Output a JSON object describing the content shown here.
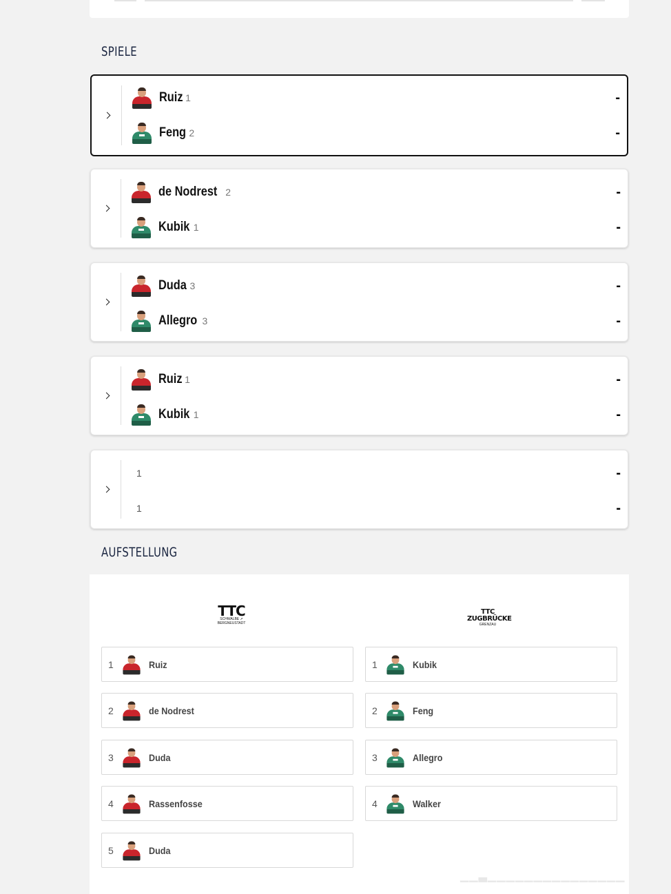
{
  "sections": {
    "games_title": "SPIELE",
    "lineup_title": "AUFSTELLUNG"
  },
  "colors": {
    "home_jersey": "#c9252c",
    "away_jersey": "#2f8a69",
    "title": "#1a2540"
  },
  "games": [
    {
      "home": {
        "name": "Ruiz",
        "seed": "1",
        "score": "-"
      },
      "away": {
        "name": "Feng",
        "seed": "2",
        "score": "-"
      }
    },
    {
      "home": {
        "name": "de Nodrest",
        "seed": "2",
        "score": "-"
      },
      "away": {
        "name": "Kubik",
        "seed": "1",
        "score": "-"
      }
    },
    {
      "home": {
        "name": "Duda",
        "seed": "3",
        "score": "-"
      },
      "away": {
        "name": "Allegro",
        "seed": "3",
        "score": "-"
      }
    },
    {
      "home": {
        "name": "Ruiz",
        "seed": "1",
        "score": "-"
      },
      "away": {
        "name": "Kubik",
        "seed": "1",
        "score": "-"
      }
    },
    {
      "home": {
        "name": "",
        "seed": "1",
        "score": "-"
      },
      "away": {
        "name": "",
        "seed": "1",
        "score": "-"
      }
    }
  ],
  "lineup": {
    "home_logo": {
      "big": "TTC",
      "small1": "SCHWALBE ➚",
      "small2": "BERGNEUSTADT"
    },
    "away_logo": {
      "big": "TTC",
      "mid": "ZUGBRÜCKE",
      "small": "GRENZAU"
    },
    "home": [
      {
        "num": "1",
        "name": "Ruiz"
      },
      {
        "num": "2",
        "name": "de Nodrest"
      },
      {
        "num": "3",
        "name": "Duda"
      },
      {
        "num": "4",
        "name": "Rassenfosse"
      },
      {
        "num": "5",
        "name": "Duda"
      }
    ],
    "away": [
      {
        "num": "1",
        "name": "Kubik"
      },
      {
        "num": "2",
        "name": "Feng"
      },
      {
        "num": "3",
        "name": "Allegro"
      },
      {
        "num": "4",
        "name": "Walker"
      }
    ]
  }
}
